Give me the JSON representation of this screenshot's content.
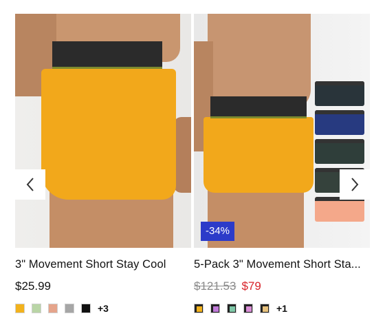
{
  "products": [
    {
      "title": "3\" Movement Short Stay Cool",
      "price": "$25.99",
      "swatches": [
        "#f2b21d",
        "#b9d5a6",
        "#e5a48b",
        "#a6a6a6",
        "#111111"
      ],
      "more_label": "+3",
      "prev_icon": "chevron-left-icon"
    },
    {
      "title": "5-Pack 3\" Movement Short Sta...",
      "original_price": "$121.53",
      "sale_price": "$79",
      "discount_badge": "-34%",
      "more_label": "+1",
      "next_icon": "chevron-right-icon",
      "pack_colors": [
        "#29343a",
        "#273a80",
        "#2f3e3a",
        "#35423c",
        "#f4a88a",
        "#f2a81b"
      ]
    }
  ]
}
